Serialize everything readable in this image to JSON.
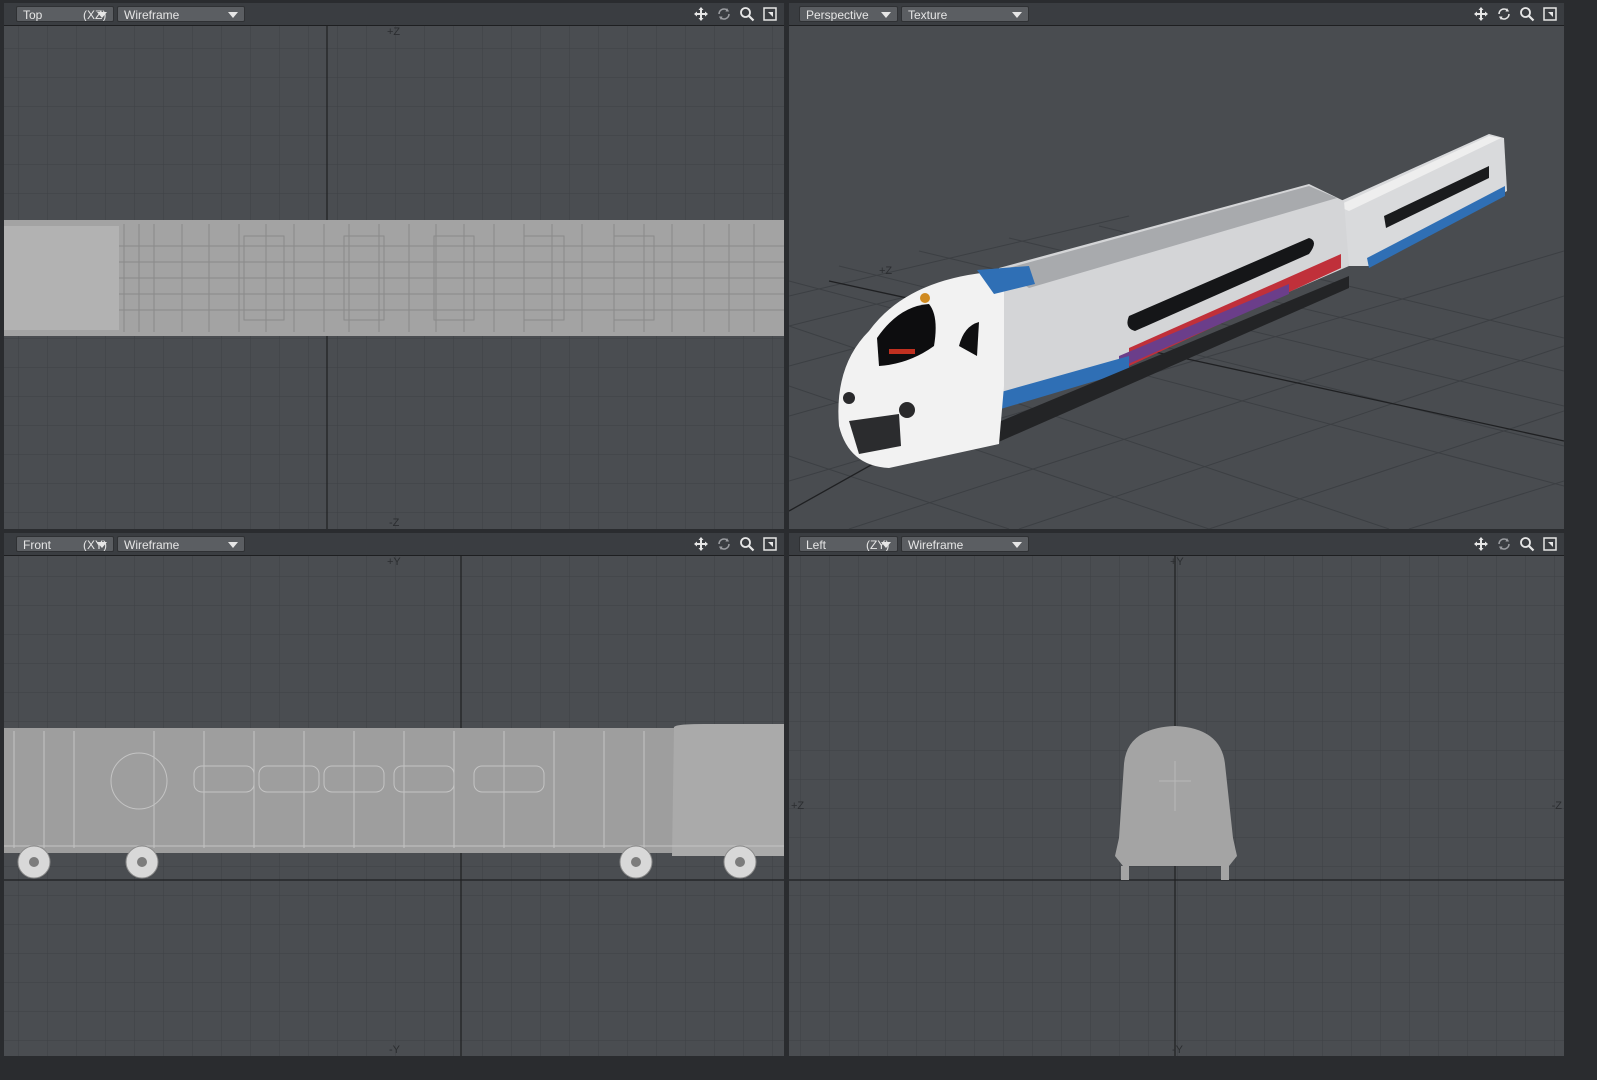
{
  "viewports": {
    "top": {
      "view": "Top",
      "axes": "(XZ)",
      "mode": "Wireframe",
      "axis_labels": {
        "up": "+Z",
        "down": "-Z"
      }
    },
    "perspective": {
      "view": "Perspective",
      "mode": "Texture",
      "axis_labels": {
        "ground": "+Z"
      }
    },
    "front": {
      "view": "Front",
      "axes": "(XY)",
      "mode": "Wireframe",
      "axis_labels": {
        "up": "+Y",
        "down": "-Y"
      }
    },
    "left": {
      "view": "Left",
      "axes": "(ZY)",
      "mode": "Wireframe",
      "axis_labels": {
        "up": "+Y",
        "down": "-Y",
        "left": "+Z",
        "right": "-Z"
      }
    }
  },
  "toolbar_icons": [
    "move-view-icon",
    "rotate-view-icon",
    "zoom-view-icon",
    "maximize-view-icon"
  ],
  "colors": {
    "viewport_bg": "#4a4d51",
    "grid": "#3a3d41",
    "axis_line": "#1f2022",
    "wireframe": "#b4b4b4",
    "train_body": "#f2f2f2",
    "stripe_blue": "#2f6fb5",
    "stripe_red": "#c0303a"
  }
}
